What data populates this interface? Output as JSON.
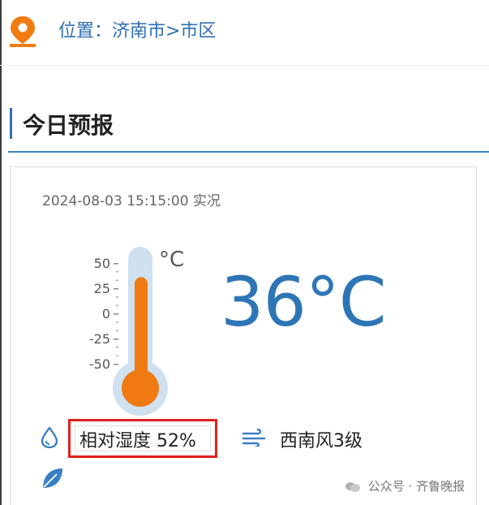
{
  "location": {
    "label": "位置：济南市>市区"
  },
  "forecast": {
    "title": "今日预报"
  },
  "observation": {
    "timestamp": "2024-08-03 15:15:00 实况",
    "temperature": "36°C",
    "unit": "°C",
    "thermometer_scale": [
      "50",
      "25",
      "0",
      "-25",
      "-50"
    ],
    "thermometer_level_celsius": 36,
    "humidity": "相对湿度 52%",
    "wind": "西南风3级"
  },
  "watermark": {
    "text": "公众号 · 齐鲁晚报"
  },
  "colors": {
    "accent": "#2e6fb3",
    "thermometer_fill": "#ef7a12",
    "highlight_box": "#e0201c"
  },
  "icons": [
    "location-pin-icon",
    "thermometer-icon",
    "water-drop-icon",
    "wind-icon",
    "leaf-icon"
  ]
}
